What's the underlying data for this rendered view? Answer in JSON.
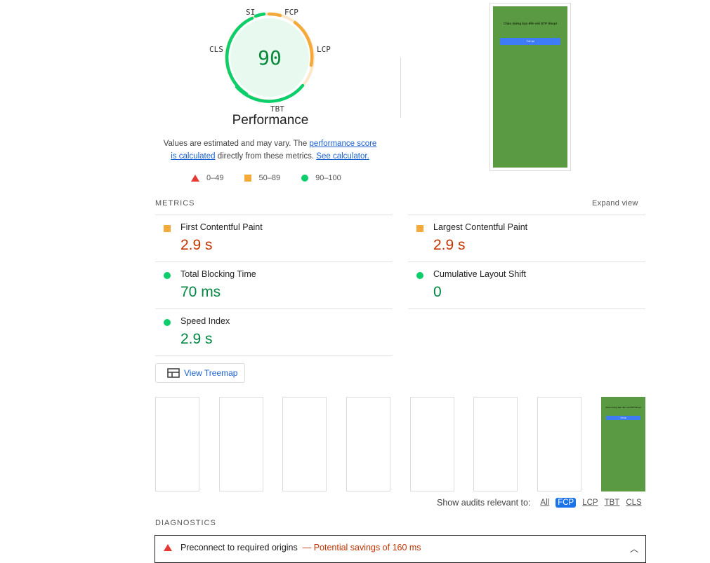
{
  "gauge": {
    "score": "90",
    "labels": {
      "si": "SI",
      "fcp": "FCP",
      "lcp": "LCP",
      "tbt": "TBT",
      "cls": "CLS"
    },
    "title": "Performance",
    "colors": {
      "pass": "#0cce6b",
      "average": "#ffa400",
      "fail": "#ff4e42",
      "score_text": "#008800"
    }
  },
  "description": {
    "prefix": "Values are estimated and may vary. The ",
    "link1": "performance score is calculated",
    "middle": " directly from these metrics. ",
    "link2": "See calculator."
  },
  "legend": {
    "fail": "0–49",
    "average": "50–89",
    "pass": "90–100"
  },
  "screenshot": {
    "title": "Chào mừng bạn đến với DTP Shop!",
    "button": "Trở lại"
  },
  "metrics": {
    "heading": "METRICS",
    "expand": "Expand view",
    "items": [
      {
        "name": "First Contentful Paint",
        "value": "2.9 s",
        "status": "average"
      },
      {
        "name": "Largest Contentful Paint",
        "value": "2.9 s",
        "status": "average"
      },
      {
        "name": "Total Blocking Time",
        "value": "70 ms",
        "status": "pass"
      },
      {
        "name": "Cumulative Layout Shift",
        "value": "0",
        "status": "pass"
      },
      {
        "name": "Speed Index",
        "value": "2.9 s",
        "status": "pass"
      }
    ]
  },
  "treemap": {
    "label": "View Treemap"
  },
  "filmstrip": {
    "final_title": "Chào mừng bạn đến với DTP Shop!",
    "final_button": "Trở lại"
  },
  "audits": {
    "label": "Show audits relevant to:",
    "filters": [
      "All",
      "FCP",
      "LCP",
      "TBT",
      "CLS"
    ],
    "active": "FCP"
  },
  "diagnostics": {
    "heading": "DIAGNOSTICS",
    "items": [
      {
        "title": "Preconnect to required origins",
        "savings": "— Potential savings of 160 ms"
      }
    ]
  }
}
